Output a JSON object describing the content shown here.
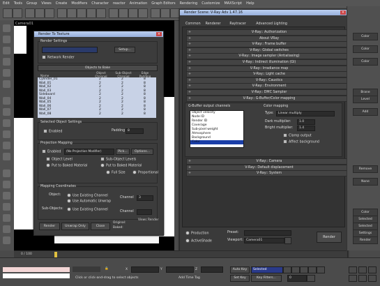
{
  "menubar": {
    "items": [
      "Edit",
      "Tools",
      "Group",
      "Views",
      "Create",
      "Modifiers",
      "Character",
      "reactor",
      "Animation",
      "Graph Editors",
      "Rendering",
      "Customize",
      "MAXScript",
      "Help"
    ]
  },
  "viewport": {
    "label": "Camera01"
  },
  "rte": {
    "title": "Render To Texture",
    "render_settings_label": "Render Settings",
    "setup_btn": "Setup...",
    "network_label": "Network Render",
    "objects_header": "Objects to Bake",
    "col_name": "Name",
    "col_object_channel": "Object Channel",
    "col_sub_object_channel": "Sub-Object Channel",
    "col_edge_padding": "Edge Padding",
    "rows": [
      {
        "name": "Cylinder_01",
        "ch": "2",
        "sub": "2",
        "pad": "8"
      },
      {
        "name": "Wall_01",
        "ch": "2",
        "sub": "2",
        "pad": "8"
      },
      {
        "name": "Wall_02",
        "ch": "2",
        "sub": "2",
        "pad": "8"
      },
      {
        "name": "Wall_03",
        "ch": "2",
        "sub": "2",
        "pad": "8"
      },
      {
        "name": "Sideboard",
        "ch": "2",
        "sub": "2",
        "pad": "8"
      },
      {
        "name": "Wall_04",
        "ch": "2",
        "sub": "2",
        "pad": "8"
      },
      {
        "name": "Wall_05",
        "ch": "2",
        "sub": "2",
        "pad": "8"
      },
      {
        "name": "Wall_06",
        "ch": "2",
        "sub": "2",
        "pad": "8"
      },
      {
        "name": "Wall_07",
        "ch": "2",
        "sub": "2",
        "pad": "8"
      },
      {
        "name": "Wall_08",
        "ch": "2",
        "sub": "2",
        "pad": "8"
      }
    ],
    "selected_settings": "Selected Object Settings",
    "enabled": "Enabled",
    "padding_label": "Padding",
    "padding_value": "8",
    "projection_mapping": "Projection Mapping",
    "pm_enabled": "Enabled",
    "pm_modifier": "(No Projection Modifier)",
    "pick_btn": "Pick...",
    "options_btn": "Options...",
    "object_level": "Object Level",
    "sub_object_levels": "Sub-Object Levels",
    "put_to_baked": "Put to Baked Material",
    "full_size": "Full Size",
    "proportional": "Proportional",
    "mapping_coords": "Mapping Coordinates",
    "object_label": "Object:",
    "use_existing": "Use Existing Channel",
    "use_auto_unwrap": "Use Automatic Unwrap",
    "channel_label": "Channel",
    "channel_value": "3",
    "sub_objects_label": "Sub-Objects:",
    "render_btn": "Render",
    "unwrap_only_btn": "Unwrap Only",
    "close_btn": "Close",
    "original_label": "Original:",
    "baked_label": "Baked:",
    "views_label": "Views",
    "render_label": "Render"
  },
  "rs": {
    "title": "Render Scene: V-Ray Adv 1.47.16",
    "tabs": [
      "Common",
      "Renderer",
      "Raytracer",
      "Advanced Lighting"
    ],
    "rollouts_top": [
      "V-Ray:: Authorization",
      "About VRay",
      "V-Ray:: Frame buffer",
      "V-Ray:: Global switches",
      "V-Ray:: Image sampler (Antialiasing)",
      "V-Ray:: Indirect illumination (GI)",
      "V-Ray:: Irradiance map",
      "V-Ray:: Light cache",
      "V-Ray:: Caustics",
      "V-Ray:: Environment",
      "V-Ray:: DMC Sampler",
      "V-Ray:: G-Buffer/Color mapping"
    ],
    "gbuffer_label": "G-Buffer output channels",
    "gbuffer_items": [
      "Object velocity",
      "Node ID",
      "Render ID",
      "Coverage",
      "Sub-pixel weight",
      "Atmosphere",
      "Background",
      "Color"
    ],
    "color_mapping_label": "Color mapping",
    "type_label": "Type:",
    "type_value": "Linear multiply",
    "dark_mult_label": "Dark multiplier:",
    "dark_mult_value": "1.0",
    "bright_mult_label": "Bright multiplier:",
    "bright_mult_value": "1.4",
    "clamp_output": "Clamp output",
    "affect_background": "Affect background",
    "rollouts_bottom": [
      "V-Ray:: Camera",
      "V-Ray:: Default displacement",
      "V-Ray:: System"
    ],
    "production_label": "Production",
    "activeshade_label": "ActiveShade",
    "preset_label": "Preset:",
    "viewport_label": "Viewport:",
    "viewport_value": "Camera01",
    "render_btn": "Render"
  },
  "rightpanel": {
    "buttons": [
      "Color",
      "Color",
      "Color",
      "Brane",
      "Level",
      "Add",
      "Remove",
      "None",
      "Color",
      "Selected",
      "Selected",
      "Settings",
      "Render"
    ]
  },
  "timeline": {
    "frame": "0 / 100",
    "ticks": [
      "0",
      "5",
      "10",
      "15",
      "20",
      "25",
      "30",
      "35",
      "40",
      "45",
      "50",
      "55",
      "60",
      "65",
      "70",
      "75",
      "80",
      "85",
      "90",
      "95",
      "100"
    ]
  },
  "status": {
    "prompt": "Click or click-and-drag to select objects",
    "add_time_tag": "Add Time Tag",
    "autokey": "Auto Key",
    "selected": "Selected",
    "setkey": "Set Key",
    "key_filters": "Key Filters...",
    "frame_value": "0",
    "x_label": "X",
    "y_label": "Y",
    "z_label": "Z"
  }
}
